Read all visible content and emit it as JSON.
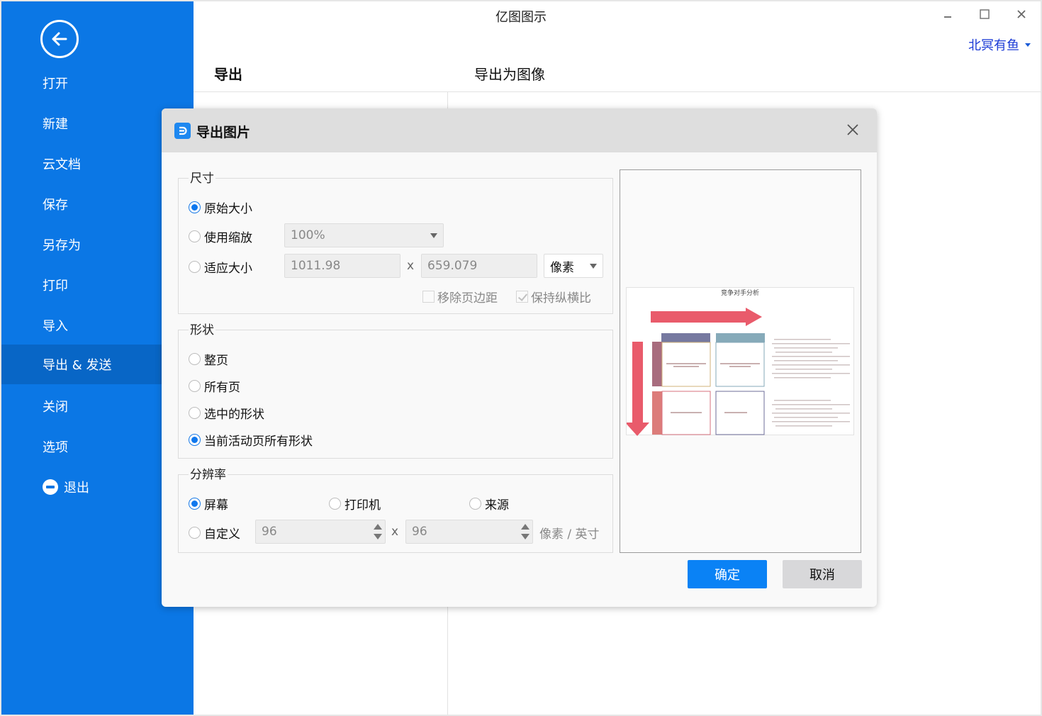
{
  "window": {
    "title": "亿图图示",
    "controls": {
      "minimize": "–",
      "maximize": "□",
      "close": "✕"
    },
    "user_name": "北冥有鱼"
  },
  "sidebar": {
    "back_icon": "back-arrow-icon",
    "items": [
      {
        "label": "打开"
      },
      {
        "label": "新建"
      },
      {
        "label": "云文档"
      },
      {
        "label": "保存"
      },
      {
        "label": "另存为"
      },
      {
        "label": "打印"
      },
      {
        "label": "导入"
      },
      {
        "label": "导出 & 发送",
        "active": true
      },
      {
        "label": "关闭"
      },
      {
        "label": "选项"
      },
      {
        "label": "退出",
        "icon": "exit-icon"
      }
    ]
  },
  "panel": {
    "left_title": "导出",
    "right_title": "导出为图像"
  },
  "dialog": {
    "title": "导出图片",
    "size": {
      "legend": "尺寸",
      "options": [
        {
          "label": "原始大小",
          "checked": true
        },
        {
          "label": "使用缩放",
          "checked": false
        },
        {
          "label": "适应大小",
          "checked": false
        }
      ],
      "zoom_value": "100%",
      "width_value": "1011.98",
      "height_value": "659.079",
      "x_label": "x",
      "unit_value": "像素",
      "remove_margin": {
        "label": "移除页边距",
        "checked": false
      },
      "keep_ratio": {
        "label": "保持纵横比",
        "checked": true
      }
    },
    "shape": {
      "legend": "形状",
      "options": [
        {
          "label": "整页",
          "checked": false
        },
        {
          "label": "所有页",
          "checked": false
        },
        {
          "label": "选中的形状",
          "checked": false
        },
        {
          "label": "当前活动页所有形状",
          "checked": true
        }
      ]
    },
    "resolution": {
      "legend": "分辨率",
      "options": [
        {
          "label": "屏幕",
          "checked": true
        },
        {
          "label": "打印机",
          "checked": false
        },
        {
          "label": "来源",
          "checked": false
        },
        {
          "label": "自定义",
          "checked": false
        }
      ],
      "dpi_x": "96",
      "dpi_y": "96",
      "x_label": "x",
      "unit_label": "像素 / 英寸"
    },
    "preview": {
      "diagram_title": "竞争对手分析",
      "colors": {
        "arrow": "#e95b6b",
        "header_left": "#7679a0",
        "header_right": "#86aab9",
        "side_top": "#a86c7e",
        "side_bottom": "#dc7c7a",
        "box_tl_border": "#d2b27a",
        "box_tr_border": "#86aab9",
        "box_bl_border": "#d7707e",
        "box_br_border": "#6e6e9a"
      }
    },
    "ok_label": "确定",
    "cancel_label": "取消"
  }
}
